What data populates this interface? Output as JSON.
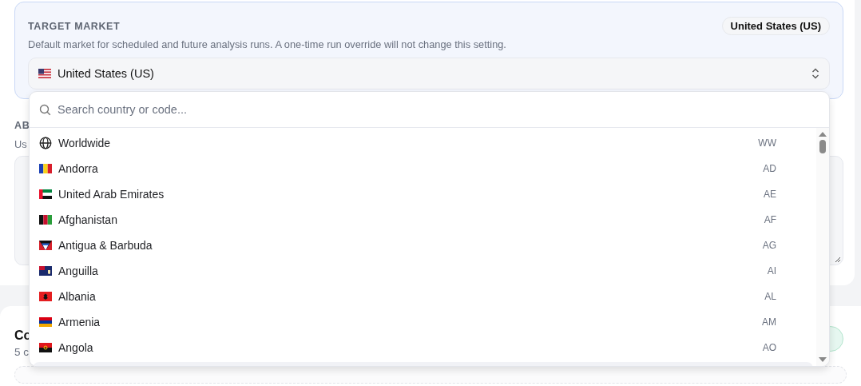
{
  "panel": {
    "title": "TARGET MARKET",
    "badge": "United States (US)",
    "description": "Default market for scheduled and future analysis runs. A one-time run override will not change this setting.",
    "select": {
      "value": "United States (US)"
    }
  },
  "background": {
    "section_label": "AB",
    "section_hint": "Us",
    "card_title": "Co",
    "card_subtitle": "5 c"
  },
  "dropdown": {
    "search": {
      "placeholder": "Search country or code..."
    },
    "options": [
      {
        "kind": "globe",
        "name": "Worldwide",
        "code": "WW"
      },
      {
        "kind": "flag",
        "name": "Andorra",
        "code": "AD"
      },
      {
        "kind": "flag",
        "name": "United Arab Emirates",
        "code": "AE"
      },
      {
        "kind": "flag",
        "name": "Afghanistan",
        "code": "AF"
      },
      {
        "kind": "flag",
        "name": "Antigua & Barbuda",
        "code": "AG"
      },
      {
        "kind": "flag",
        "name": "Anguilla",
        "code": "AI"
      },
      {
        "kind": "flag",
        "name": "Albania",
        "code": "AL"
      },
      {
        "kind": "flag",
        "name": "Armenia",
        "code": "AM"
      },
      {
        "kind": "flag",
        "name": "Angola",
        "code": "AO"
      }
    ]
  }
}
